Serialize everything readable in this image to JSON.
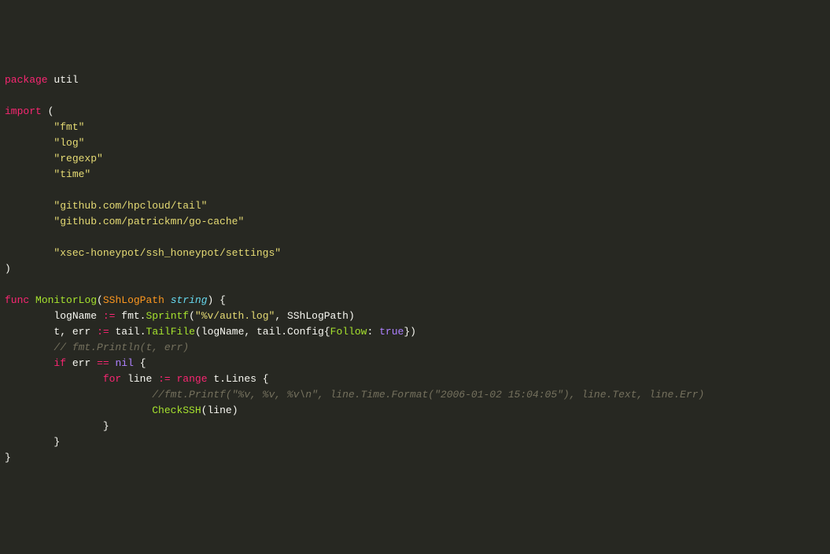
{
  "t": {
    "package": "package",
    "util": "util",
    "import": "import",
    "fmt": "\"fmt\"",
    "log": "\"log\"",
    "regexp": "\"regexp\"",
    "time": "\"time\"",
    "github_tail": "\"github.com/hpcloud/tail\"",
    "github_cache": "\"github.com/patrickmn/go-cache\"",
    "xsec": "\"xsec-honeypot/ssh_honeypot/settings\"",
    "func": "func",
    "MonitorLog": "MonitorLog",
    "SShLogPath": "SShLogPath",
    "string": "string",
    "logName": "logName",
    "decl": ":=",
    "fmt_pkg": "fmt",
    "Sprintf": "Sprintf",
    "authlog": "\"%v/auth.log\"",
    "t_var": "t",
    "err": "err",
    "tail_pkg": "tail",
    "TailFile": "TailFile",
    "Config": "Config",
    "Follow": "Follow",
    "true": "true",
    "comment1": "// fmt.Println(t, err)",
    "if": "if",
    "eq": "==",
    "nil": "nil",
    "for": "for",
    "line": "line",
    "range": "range",
    "Lines": "Lines",
    "comment2": "//fmt.Printf(\"%v, %v, %v\\n\", line.Time.Format(\"2006-01-02 15:04:05\"), line.Text, line.Err)",
    "CheckSSH": "CheckSSH"
  }
}
